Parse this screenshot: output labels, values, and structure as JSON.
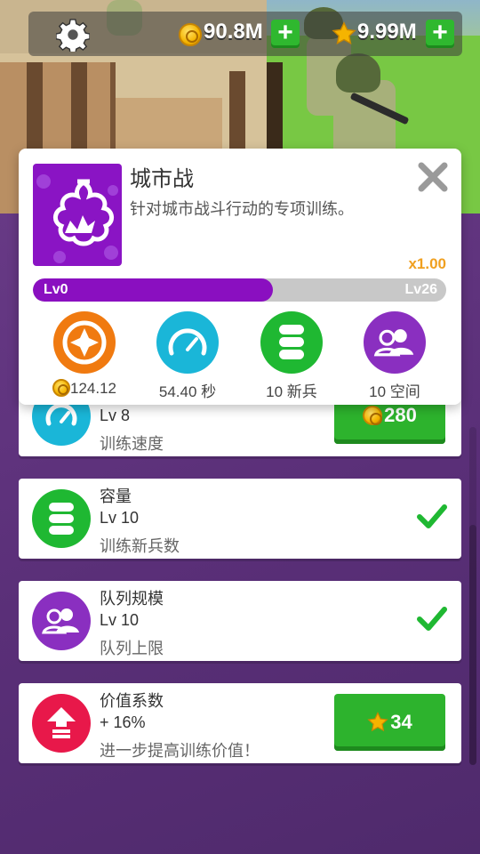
{
  "hud": {
    "coins": "90.8M",
    "stars": "9.99M",
    "coin_icon": "coin-icon",
    "star_icon": "star-icon",
    "settings_icon": "gear-icon"
  },
  "popup": {
    "title": "城市战",
    "description": "针对城市战斗行动的专项训练。",
    "multiplier": "x1.00",
    "level_start": "Lv0",
    "level_end": "Lv26",
    "progress_fraction": 0.58,
    "stats": [
      {
        "label": "124.12",
        "icon": "compass-icon",
        "color": "#f07a10"
      },
      {
        "label": "54.40 秒",
        "icon": "speedometer-icon",
        "color": "#1ab6d8"
      },
      {
        "label": "10 新兵",
        "icon": "stack-icon",
        "color": "#1fb832"
      },
      {
        "label": "10 空间",
        "icon": "users-icon",
        "color": "#8a2fc0"
      }
    ]
  },
  "upgrades": [
    {
      "name": "",
      "level": "Lv 8",
      "sub": "训练速度",
      "button": "280",
      "icon": "speedometer-icon",
      "color": "#1ab6d8"
    },
    {
      "name": "容量",
      "level": "Lv 10",
      "sub": "训练新兵数",
      "icon": "stack-icon",
      "color": "#1fb832"
    },
    {
      "name": "队列规模",
      "level": "Lv 10",
      "sub": "队列上限",
      "icon": "users-icon",
      "color": "#8a2fc0"
    },
    {
      "name": "价值系数",
      "level": "+ 16%",
      "sub": "进一步提高训练价值！",
      "button": "34",
      "icon": "arrow-up-icon",
      "color": "#e8184a"
    }
  ],
  "colors": {
    "accent_purple": "#8a0fc0",
    "buy_green": "#2db32d",
    "check_green": "#1fb832",
    "multiplier_orange": "#f0a020"
  }
}
